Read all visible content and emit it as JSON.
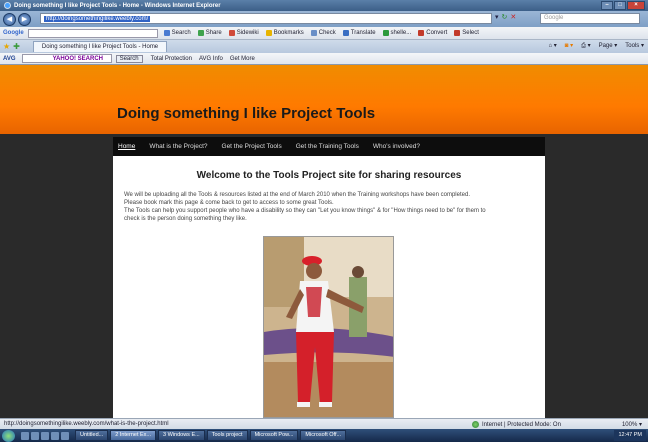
{
  "window": {
    "title": "Doing something I like Project Tools - Home - Windows Internet Explorer"
  },
  "address_bar": {
    "url": "http://doingsomethingilike.weebly.com/",
    "search_placeholder": "Google"
  },
  "google_toolbar": {
    "logo": "Google",
    "items": [
      "Search",
      "Share",
      "Sidewiki",
      "Bookmarks",
      "Check",
      "Translate",
      "shelle...",
      "Convert",
      "Select"
    ]
  },
  "tab_bar": {
    "tab_label": "Doing something I like Project Tools - Home",
    "page_menu": "Page",
    "tools_menu": "Tools"
  },
  "avg_bar": {
    "logo": "AVG",
    "yahoo_label": "YAHOO! SEARCH",
    "search_button": "Search",
    "items": [
      "Total Protection",
      "AVG Info",
      "Get More"
    ]
  },
  "site": {
    "title": "Doing something I like Project Tools",
    "nav": [
      "Home",
      "What is the Project?",
      "Get the Project Tools",
      "Get the Training Tools",
      "Who's involved?"
    ],
    "welcome_heading": "Welcome to the Tools Project site for sharing resources",
    "paragraph_lines": [
      "We will be uploading all the Tools & resources listed at the end of March 2010 when the Training workshops have been completed.",
      "Please book mark this page & come back to get to access to some great Tools.",
      "The Tools can help you support people who have a disability so they can \"Let you know things\" & for \"How things need to be\" for them to",
      "check is the person doing something they like."
    ]
  },
  "status_bar": {
    "link_url": "http://doingsomethingilike.weebly.com/what-is-the-project.html",
    "zone": "Internet | Protected Mode: On",
    "zoom": "100%"
  },
  "taskbar": {
    "tasks": [
      "Untitled...",
      "2 Internet Ex...",
      "3 Windows E...",
      "Tools project",
      "Microsoft Pow...",
      "Microsoft Off..."
    ],
    "clock": "12:47 PM"
  }
}
